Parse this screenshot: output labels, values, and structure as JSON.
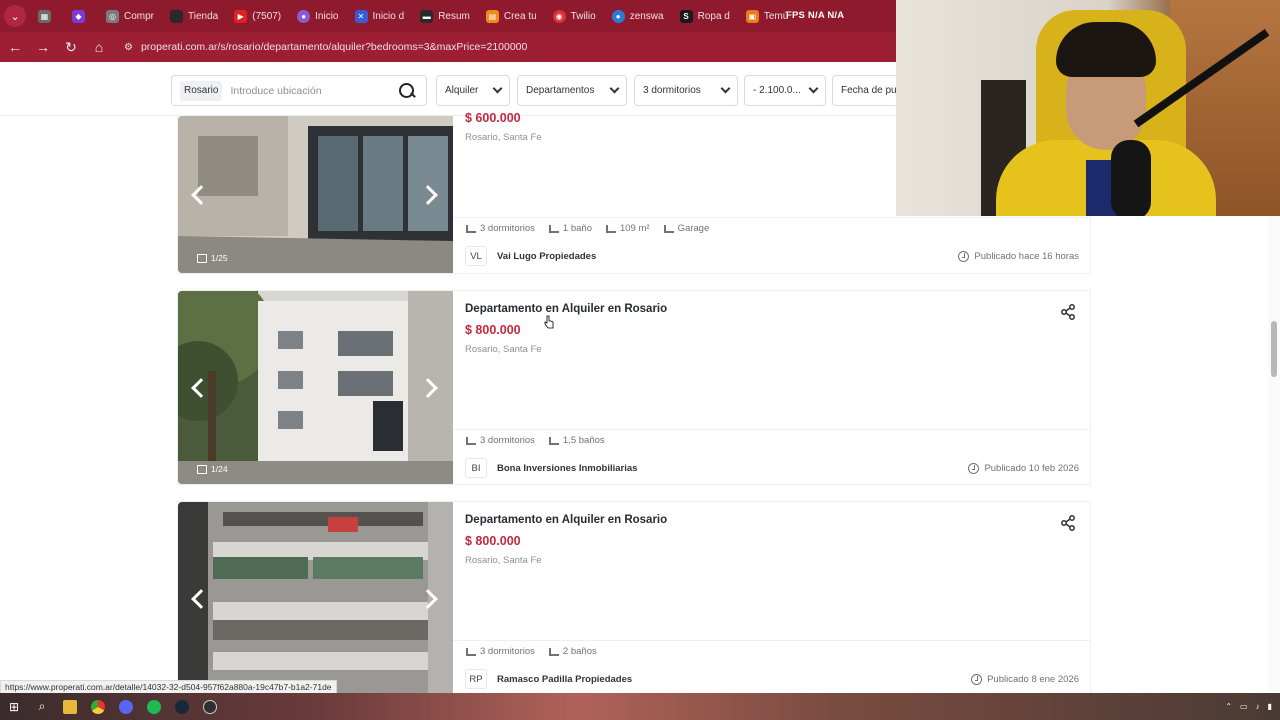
{
  "browser": {
    "tabs": [
      {
        "label": "",
        "icon": "app-icon",
        "color": "#6b6b6b"
      },
      {
        "label": "",
        "icon": "twitch-icon",
        "color": "#7a3cd6"
      },
      {
        "label": "Compr",
        "icon": "globe-icon",
        "color": "#7a7a7a"
      },
      {
        "label": "Tienda",
        "icon": "store-icon",
        "color": "#2a2a2a"
      },
      {
        "label": "(7507)",
        "icon": "youtube-icon",
        "color": "#e02222"
      },
      {
        "label": "Inicio",
        "icon": "round-icon",
        "color": "#8a5ad6"
      },
      {
        "label": "Inicio d",
        "icon": "x-icon",
        "color": "#3a5ad6"
      },
      {
        "label": "Resum",
        "icon": "doc-icon",
        "color": "#2a2a2a"
      },
      {
        "label": "Crea tu",
        "icon": "orange-icon",
        "color": "#f08a1a"
      },
      {
        "label": "Twilio",
        "icon": "twilio-icon",
        "color": "#e0303a"
      },
      {
        "label": "zenswa",
        "icon": "blue-icon",
        "color": "#2a7ad6"
      },
      {
        "label": "Ropa d",
        "icon": "s-icon",
        "color": "#1a1a1a"
      },
      {
        "label": "Temú",
        "icon": "temu-icon",
        "color": "#f07a1a"
      }
    ],
    "url": "properati.com.ar/s/rosario/departamento/alquiler?bedrooms=3&maxPrice=2100000",
    "status_url": "https://www.properati.com.ar/detalle/14032-32-d504-957f62a880a-19c47b7-b1a2-71de"
  },
  "overlay": {
    "fps": "FPS N/A N/A"
  },
  "filters": {
    "location_chip": "Rosario",
    "search_placeholder": "Introduce ubicación",
    "operation": "Alquiler",
    "property_type": "Departamentos",
    "bedrooms": "3 dormitorios",
    "price": "- 2.100.0...",
    "date": "Fecha de pu"
  },
  "listings": [
    {
      "title": "",
      "price": "$ 600.000",
      "location": "Rosario, Santa Fe",
      "features": [
        "3 dormitorios",
        "1 baño",
        "109 m²",
        "Garage"
      ],
      "agency_initials": "VL",
      "agency": "Vai Lugo Propiedades",
      "published": "Publicado hace 16 horas",
      "photo_count": "1/25"
    },
    {
      "title": "Departamento en Alquiler en Rosario",
      "price": "$ 800.000",
      "location": "Rosario, Santa Fe",
      "features": [
        "3 dormitorios",
        "1,5 baños"
      ],
      "agency_initials": "BI",
      "agency": "Bona Inversiones Inmobiliarias",
      "published": "Publicado 10 feb 2026",
      "photo_count": "1/24"
    },
    {
      "title": "Departamento en Alquiler en Rosario",
      "price": "$ 800.000",
      "location": "Rosario, Santa Fe",
      "features": [
        "3 dormitorios",
        "2 baños"
      ],
      "agency_initials": "RP",
      "agency": "Ramasco Padilla Propiedades",
      "published": "Publicado 8 ene 2026",
      "photo_count": ""
    }
  ],
  "colors": {
    "browser_bar": "#9c1f34",
    "price": "#c8283f"
  }
}
